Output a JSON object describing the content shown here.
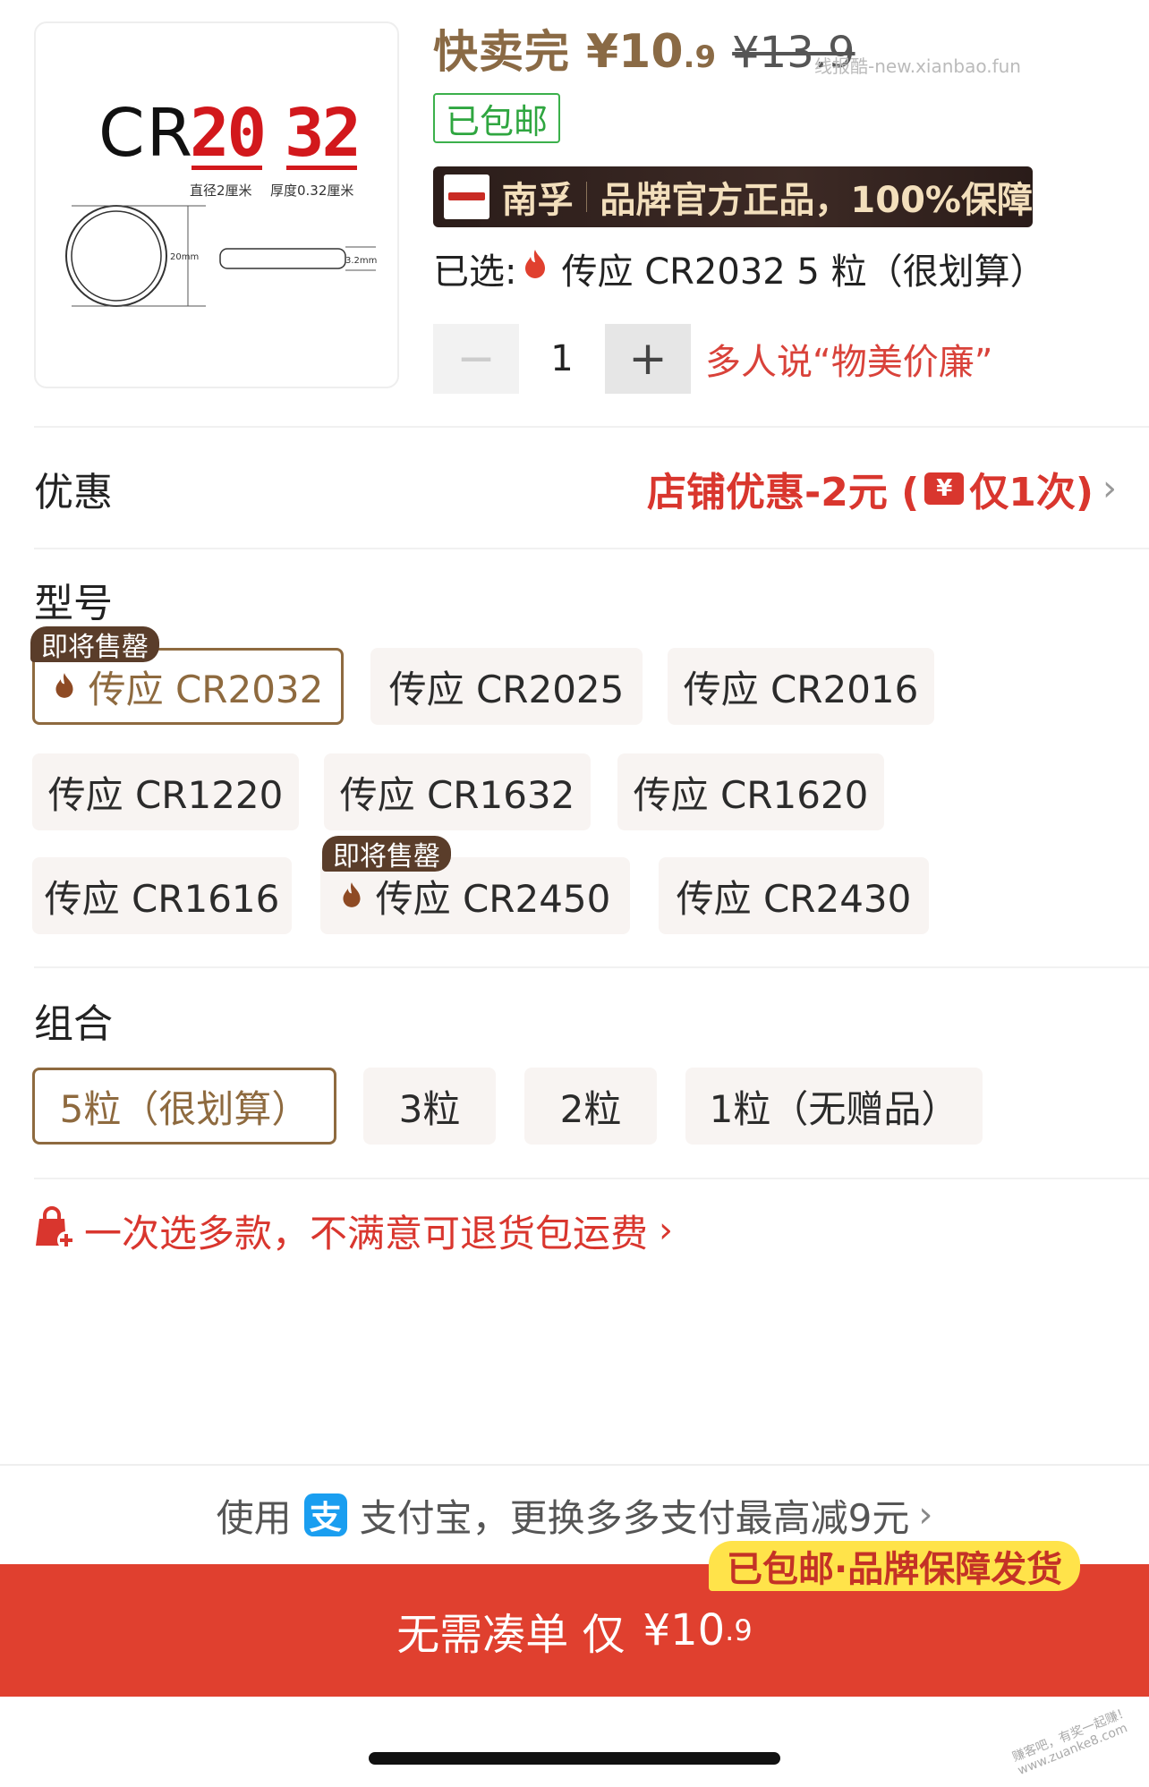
{
  "product": {
    "image": {
      "prefix": "CR",
      "num_a": "20",
      "num_b": "32",
      "diameter_label": "直径2厘米",
      "thickness_label": "厚度0.32厘米",
      "diameter_mm": "20mm",
      "thickness_mm": "3.2mm"
    },
    "price_tag": "快卖完",
    "price_integer": "¥10",
    "price_decimal": ".9",
    "original_price": "¥13.9",
    "watermark": "线报酷-new.xianbao.fun",
    "free_shipping": "已包邮",
    "brand_name": "南孚",
    "brand_slogan": "品牌官方正品，100%保障",
    "selected_label": "已选:",
    "selected_value": "传应 CR2032 5 粒（很划算）",
    "quantity": "1",
    "quantity_minus": "−",
    "quantity_plus": "+",
    "quantity_hint": "多人说“物美价廉”"
  },
  "discount": {
    "title": "优惠",
    "value_prefix": "店铺优惠-2元 (",
    "coupon_icon_glyph": "¥",
    "value_suffix": "仅1次)"
  },
  "model": {
    "title": "型号",
    "soon_label": "即将售罄",
    "options": [
      {
        "label": "传应 CR2032",
        "selected": true,
        "selling_out": true
      },
      {
        "label": "传应 CR2025",
        "selected": false
      },
      {
        "label": "传应 CR2016",
        "selected": false
      },
      {
        "label": "传应 CR1220",
        "selected": false
      },
      {
        "label": "传应 CR1632",
        "selected": false
      },
      {
        "label": "传应 CR1620",
        "selected": false
      },
      {
        "label": "传应 CR1616",
        "selected": false
      },
      {
        "label": "传应 CR2450",
        "selected": false,
        "selling_out": true
      },
      {
        "label": "传应 CR2430",
        "selected": false
      }
    ]
  },
  "bundle": {
    "title": "组合",
    "options": [
      {
        "label": "5粒（很划算）",
        "selected": true
      },
      {
        "label": "3粒",
        "selected": false
      },
      {
        "label": "2粒",
        "selected": false
      },
      {
        "label": "1粒（无赠品）",
        "selected": false
      }
    ]
  },
  "promo": {
    "text": "一次选多款，不满意可退货包运费"
  },
  "payment": {
    "use_label": "使用",
    "alipay_glyph": "支",
    "text": "支付宝，更换多多支付最高减9元"
  },
  "buy": {
    "badge": "已包邮·品牌保障发货",
    "text": "无需凑单 仅",
    "price_integer": "¥10",
    "price_decimal": ".9"
  },
  "footer": {
    "watermark_line1": "赚客吧，有奖一起赚！",
    "watermark_line2": "www.zuanke8.com"
  },
  "colors": {
    "accent_gold": "#8e6a3f",
    "accent_red": "#d9362e",
    "buy_bar": "#e0402f",
    "ship_badge": "#ffe34a",
    "green_badge": "#2fa640"
  },
  "icons": {
    "chevron": "chevron-right-icon",
    "fire": "fire-icon",
    "coupon": "coupon-icon",
    "bag": "shopping-bag-plus-icon",
    "alipay": "alipay-icon"
  }
}
